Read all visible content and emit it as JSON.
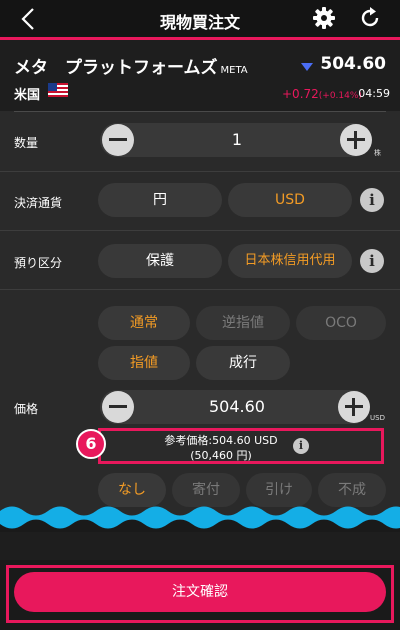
{
  "header": {
    "title": "現物買注文"
  },
  "stock": {
    "name": "メタ　プラットフォームズ",
    "ticker": "META",
    "price": "504.60",
    "country": "米国",
    "change": "+0.72",
    "change_pct": "(+0.14%)",
    "time": "04:59"
  },
  "quantity": {
    "label": "数量",
    "value": "1",
    "unit": "株"
  },
  "settlement": {
    "label": "決済通貨",
    "options": [
      "円",
      "USD"
    ],
    "selected": "USD"
  },
  "custody": {
    "label": "預り区分",
    "options": [
      "保護",
      "日本株信用代用"
    ],
    "selected": "日本株信用代用"
  },
  "order_type": {
    "options": [
      "通常",
      "逆指値",
      "OCO"
    ],
    "selected": "通常"
  },
  "price_type": {
    "options": [
      "指値",
      "成行"
    ],
    "selected": "指値"
  },
  "price": {
    "label": "価格",
    "value": "504.60",
    "unit": "USD"
  },
  "reference": {
    "line1": "参考価格:504.60 USD",
    "line2": "(50,460 円)"
  },
  "step_marker": "6",
  "conditions": {
    "options": [
      "なし",
      "寄付",
      "引け",
      "不成"
    ],
    "selected": "なし"
  },
  "footer": {
    "confirm_label": "注文確認"
  },
  "colors": {
    "accent": "#e8185c",
    "orange": "#f29b25",
    "down_arrow": "#4b6ef5"
  },
  "icons": [
    "back-icon",
    "gear-icon",
    "refresh-icon",
    "us-flag-icon",
    "down-triangle-icon",
    "minus-icon",
    "plus-icon",
    "info-icon"
  ]
}
